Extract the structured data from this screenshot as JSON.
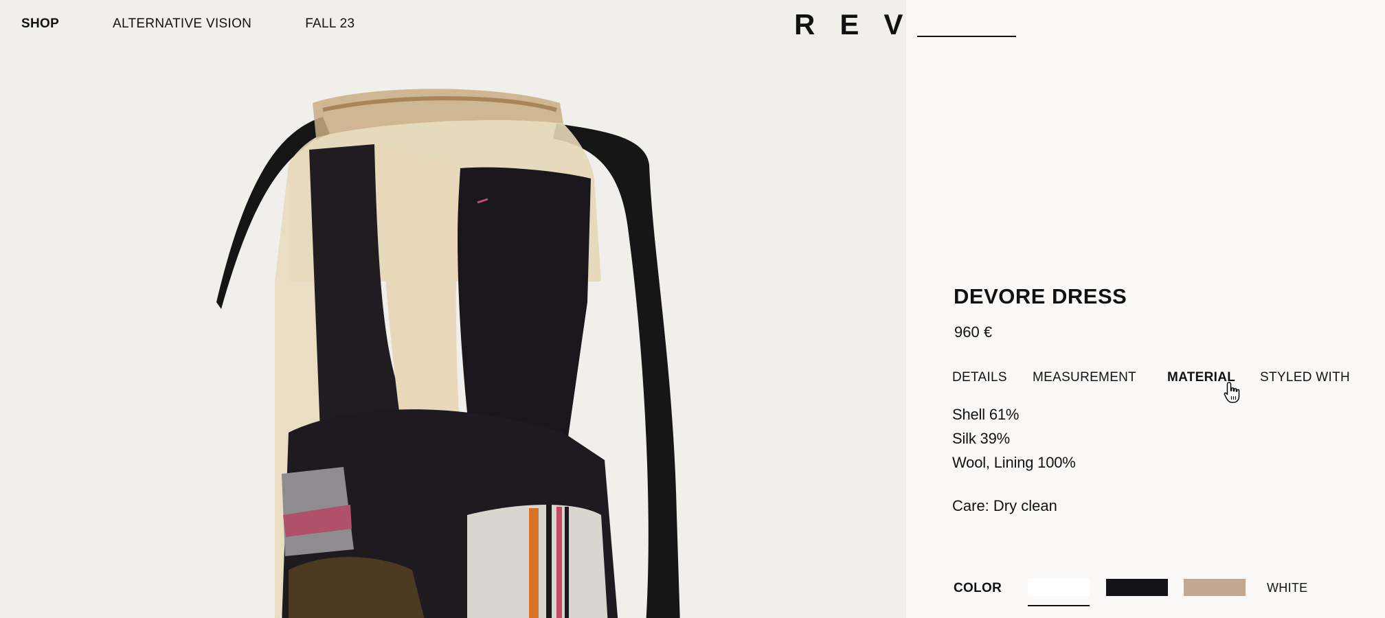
{
  "nav": {
    "items": [
      {
        "label": "SHOP",
        "active": true
      },
      {
        "label": "ALTERNATIVE VISION",
        "active": false
      },
      {
        "label": "FALL 23",
        "active": false
      }
    ]
  },
  "brand": {
    "logo": "REV"
  },
  "product": {
    "name": "DEVORE DRESS",
    "price": "960 €",
    "image_icon": "dress-photo"
  },
  "tabs": [
    {
      "label": "DETAILS",
      "active": false
    },
    {
      "label": "MEASUREMENT",
      "active": false
    },
    {
      "label": "MATERIAL",
      "active": true
    },
    {
      "label": "STYLED WITH",
      "active": false
    }
  ],
  "material": {
    "lines": [
      "Shell 61%",
      "Silk 39%",
      "Wool, Lining 100%"
    ],
    "care": "Care: Dry clean"
  },
  "color": {
    "label": "COLOR",
    "swatches": [
      {
        "name": "white",
        "hex": "#ffffff",
        "selected": true
      },
      {
        "name": "black",
        "hex": "#15131a",
        "selected": false
      },
      {
        "name": "beige",
        "hex": "#c0a892",
        "selected": false
      }
    ],
    "selected_name": "WHITE"
  },
  "cursor_icon": "hand-pointer-icon"
}
